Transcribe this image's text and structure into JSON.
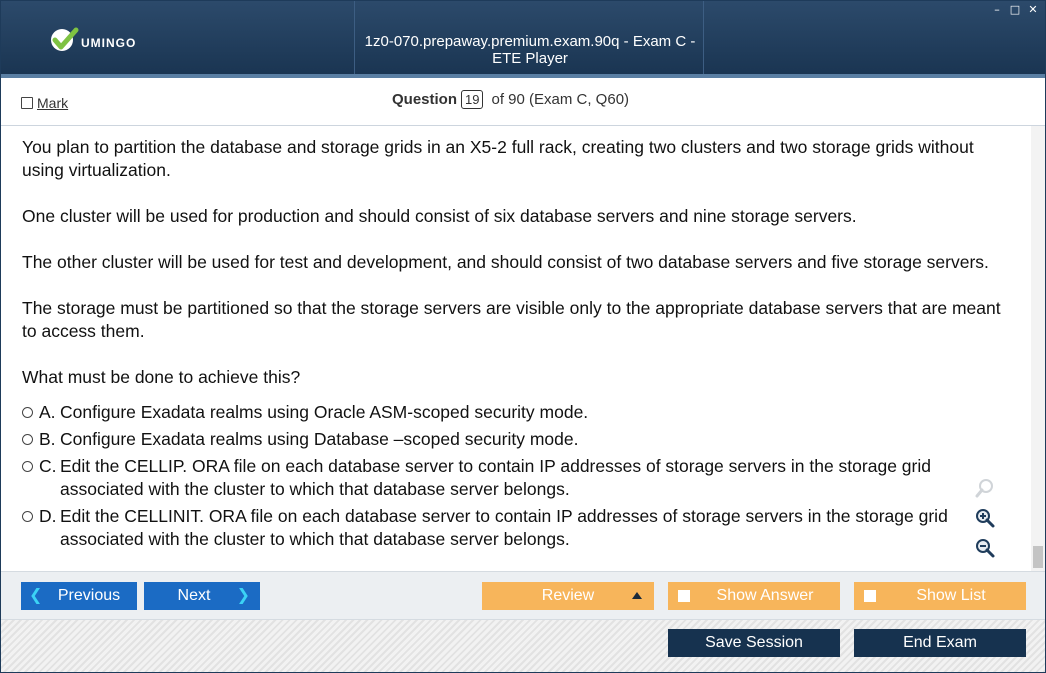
{
  "app": {
    "logo_text": "UMINGO",
    "window_title": "1z0-070.prepaway.premium.exam.90q - Exam C - ETE Player",
    "controls": {
      "minimize": "–",
      "maximize": "□",
      "close": "✕"
    }
  },
  "header": {
    "mark_label": "Mark",
    "question_label": "Question",
    "question_number": "19",
    "question_of": "of 90 (Exam C, Q60)"
  },
  "question": {
    "paragraphs": [
      "You plan to partition the database and storage grids in an X5-2 full rack, creating two clusters and two storage grids without using virtualization.",
      "One cluster will be used for production and should consist of six database servers and nine storage servers.",
      "The other cluster will be used for test and development, and should consist of two database servers and five storage servers.",
      "The storage must be partitioned so that the storage servers are visible only to the appropriate database servers that are meant to access them.",
      "What must be done to achieve this?"
    ],
    "options": [
      {
        "letter": "A.",
        "text": "Configure Exadata realms using Oracle ASM-scoped security mode."
      },
      {
        "letter": "B.",
        "text": "Configure Exadata realms using Database –scoped security mode."
      },
      {
        "letter": "C.",
        "text": "Edit the CELLIP. ORA file on each database server to contain IP addresses of storage servers in the storage grid associated with the cluster to which that database server belongs."
      },
      {
        "letter": "D.",
        "text": "Edit the CELLINIT. ORA file on each database server to contain IP addresses of storage servers in the storage grid associated with the cluster to which that database server belongs."
      }
    ]
  },
  "nav": {
    "previous": "Previous",
    "next": "Next",
    "review": "Review",
    "show_answer": "Show Answer",
    "show_list": "Show List"
  },
  "footer": {
    "save_session": "Save Session",
    "end_exam": "End Exam"
  },
  "colors": {
    "titlebar": "#1f3c5b",
    "blue_button": "#1b6bc4",
    "orange_button": "#f7b55b",
    "navy_button": "#16324f",
    "chevron": "#3bd3f5",
    "logo_check": "#7ec242"
  }
}
